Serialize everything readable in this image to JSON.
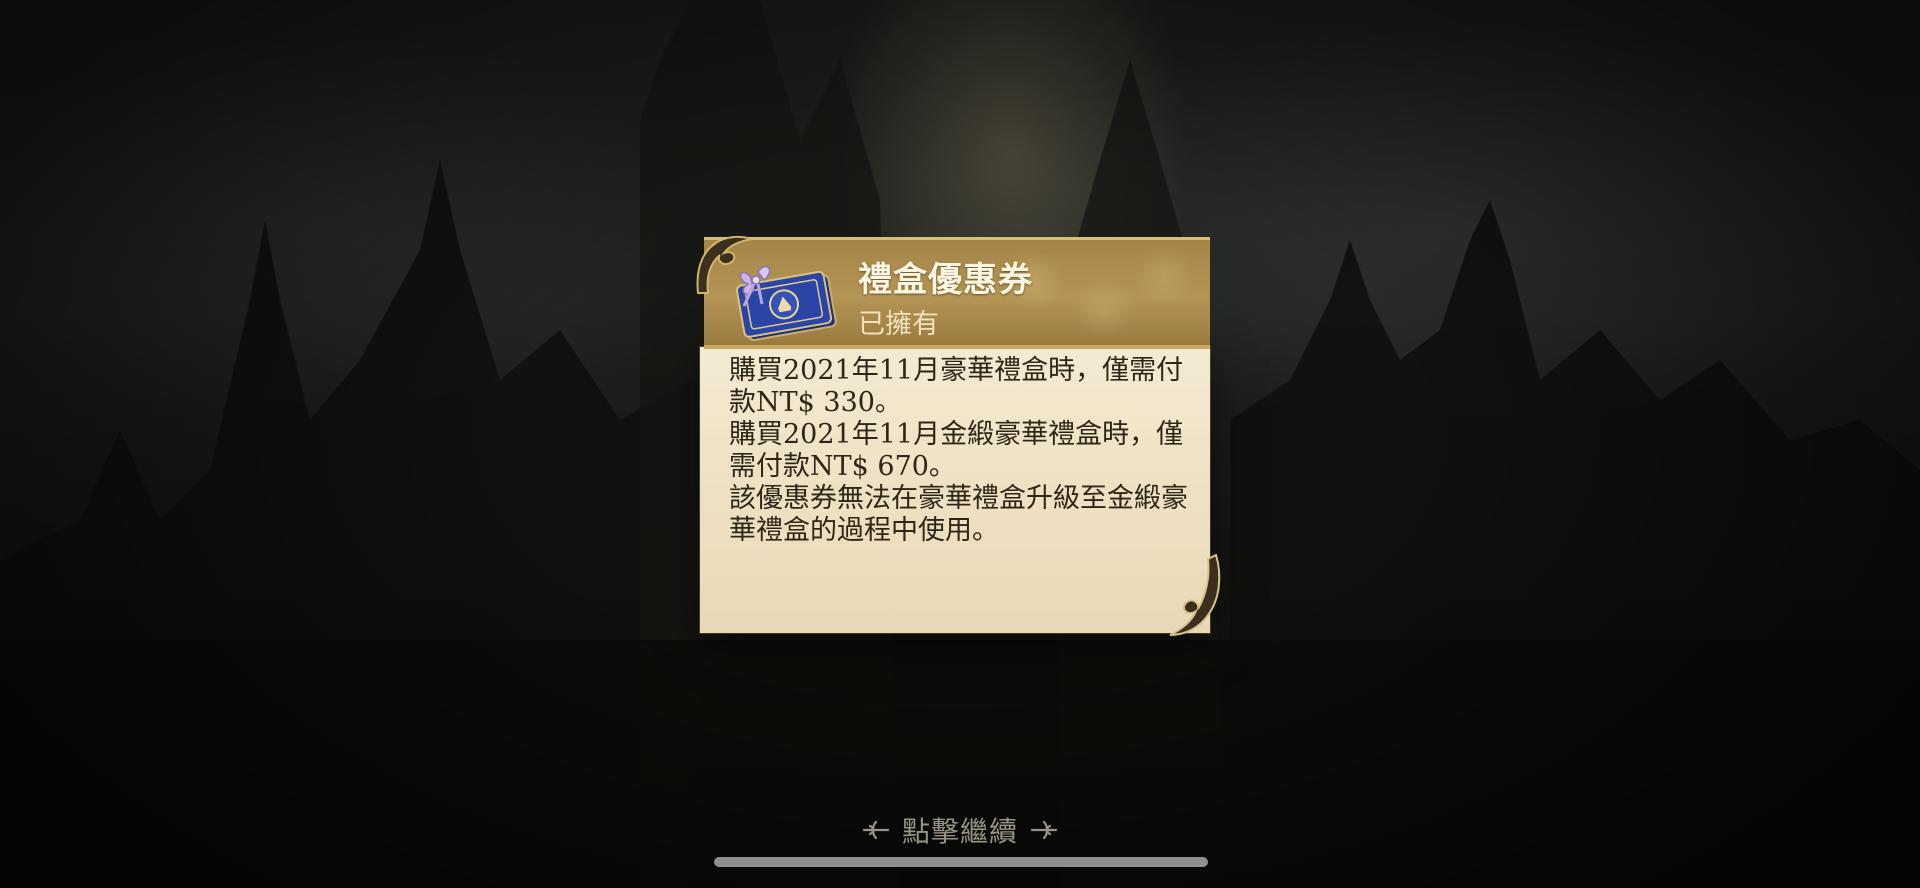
{
  "popup": {
    "title": "禮盒優惠券",
    "status": "已擁有",
    "description": [
      "購買2021年11月豪華禮盒時，僅需付款NT$ 330。",
      "購買2021年11月金緞豪華禮盒時，僅需付款NT$ 670。",
      "該優惠券無法在豪華禮盒升級至金緞豪華禮盒的過程中使用。"
    ],
    "icon": "gift-box-coupon-ticket-icon"
  },
  "footer": {
    "continue_label": "點擊繼續"
  },
  "colors": {
    "header_gold": "#b49556",
    "paper": "#f2e6cc",
    "body_text": "#2e2718",
    "title_text": "#fdf6e3",
    "continue_text": "#9a9486"
  }
}
